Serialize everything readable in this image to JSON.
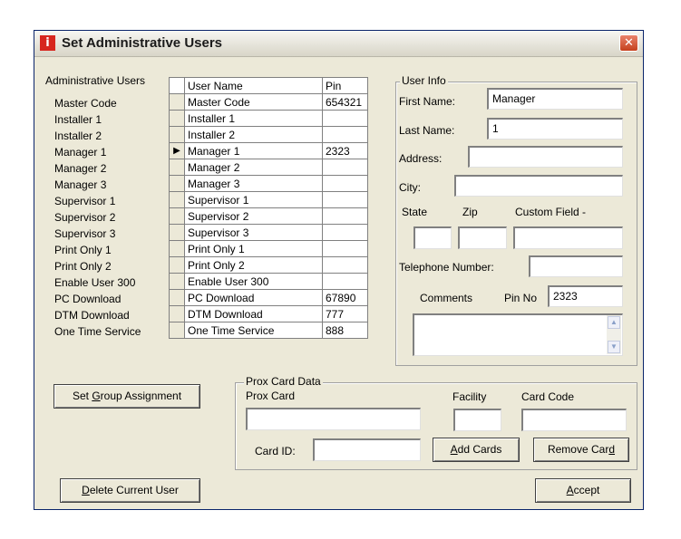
{
  "window": {
    "title": "Set Administrative Users",
    "app_icon_glyph": "i",
    "close_glyph": "✕"
  },
  "admin_users": {
    "label": "Administrative Users",
    "items": [
      "Master Code",
      "Installer 1",
      "Installer 2",
      "Manager 1",
      "Manager 2",
      "Manager 3",
      "Supervisor 1",
      "Supervisor 2",
      "Supervisor 3",
      "Print Only 1",
      "Print Only 2",
      "Enable User 300",
      "PC Download",
      "DTM Download",
      "One Time Service"
    ]
  },
  "grid": {
    "columns": [
      "User Name",
      "Pin"
    ],
    "selected_marker": "▶",
    "rows": [
      {
        "name": "Master Code",
        "pin": "654321"
      },
      {
        "name": "Installer 1",
        "pin": ""
      },
      {
        "name": "Installer 2",
        "pin": ""
      },
      {
        "name": "Manager 1",
        "pin": "2323"
      },
      {
        "name": "Manager 2",
        "pin": ""
      },
      {
        "name": "Manager 3",
        "pin": ""
      },
      {
        "name": "Supervisor 1",
        "pin": ""
      },
      {
        "name": "Supervisor 2",
        "pin": ""
      },
      {
        "name": "Supervisor 3",
        "pin": ""
      },
      {
        "name": "Print Only 1",
        "pin": ""
      },
      {
        "name": "Print Only 2",
        "pin": ""
      },
      {
        "name": "Enable User 300",
        "pin": ""
      },
      {
        "name": "PC Download",
        "pin": "67890"
      },
      {
        "name": "DTM Download",
        "pin": "777"
      },
      {
        "name": "One Time Service",
        "pin": "888"
      }
    ]
  },
  "user_info": {
    "title": "User Info",
    "first_name_label": "First Name:",
    "first_name_value": "Manager",
    "last_name_label": "Last Name:",
    "last_name_value": "1",
    "address_label": "Address:",
    "address_value": "",
    "city_label": "City:",
    "city_value": "",
    "state_label": "State",
    "zip_label": "Zip",
    "custom_field_label": "Custom Field -",
    "telephone_label": "Telephone Number:",
    "telephone_value": "",
    "comments_label": "Comments",
    "pin_no_label": "Pin No",
    "pin_no_value": "2323",
    "comments_value": ""
  },
  "prox_card": {
    "title": "Prox Card Data",
    "prox_card_label": "Prox Card",
    "facility_label": "Facility",
    "card_code_label": "Card Code",
    "card_id_label": "Card ID:"
  },
  "buttons": {
    "set_group_pre": "Set ",
    "set_group_key": "G",
    "set_group_post": "roup Assignment",
    "add_cards_key": "A",
    "add_cards_post": "dd Cards",
    "remove_card_pre": "Remove Car",
    "remove_card_key": "d",
    "delete_user_key": "D",
    "delete_user_post": "elete Current User",
    "accept_key": "A",
    "accept_post": "ccept"
  },
  "scroll_icons": {
    "up": "▲",
    "down": "▼"
  }
}
